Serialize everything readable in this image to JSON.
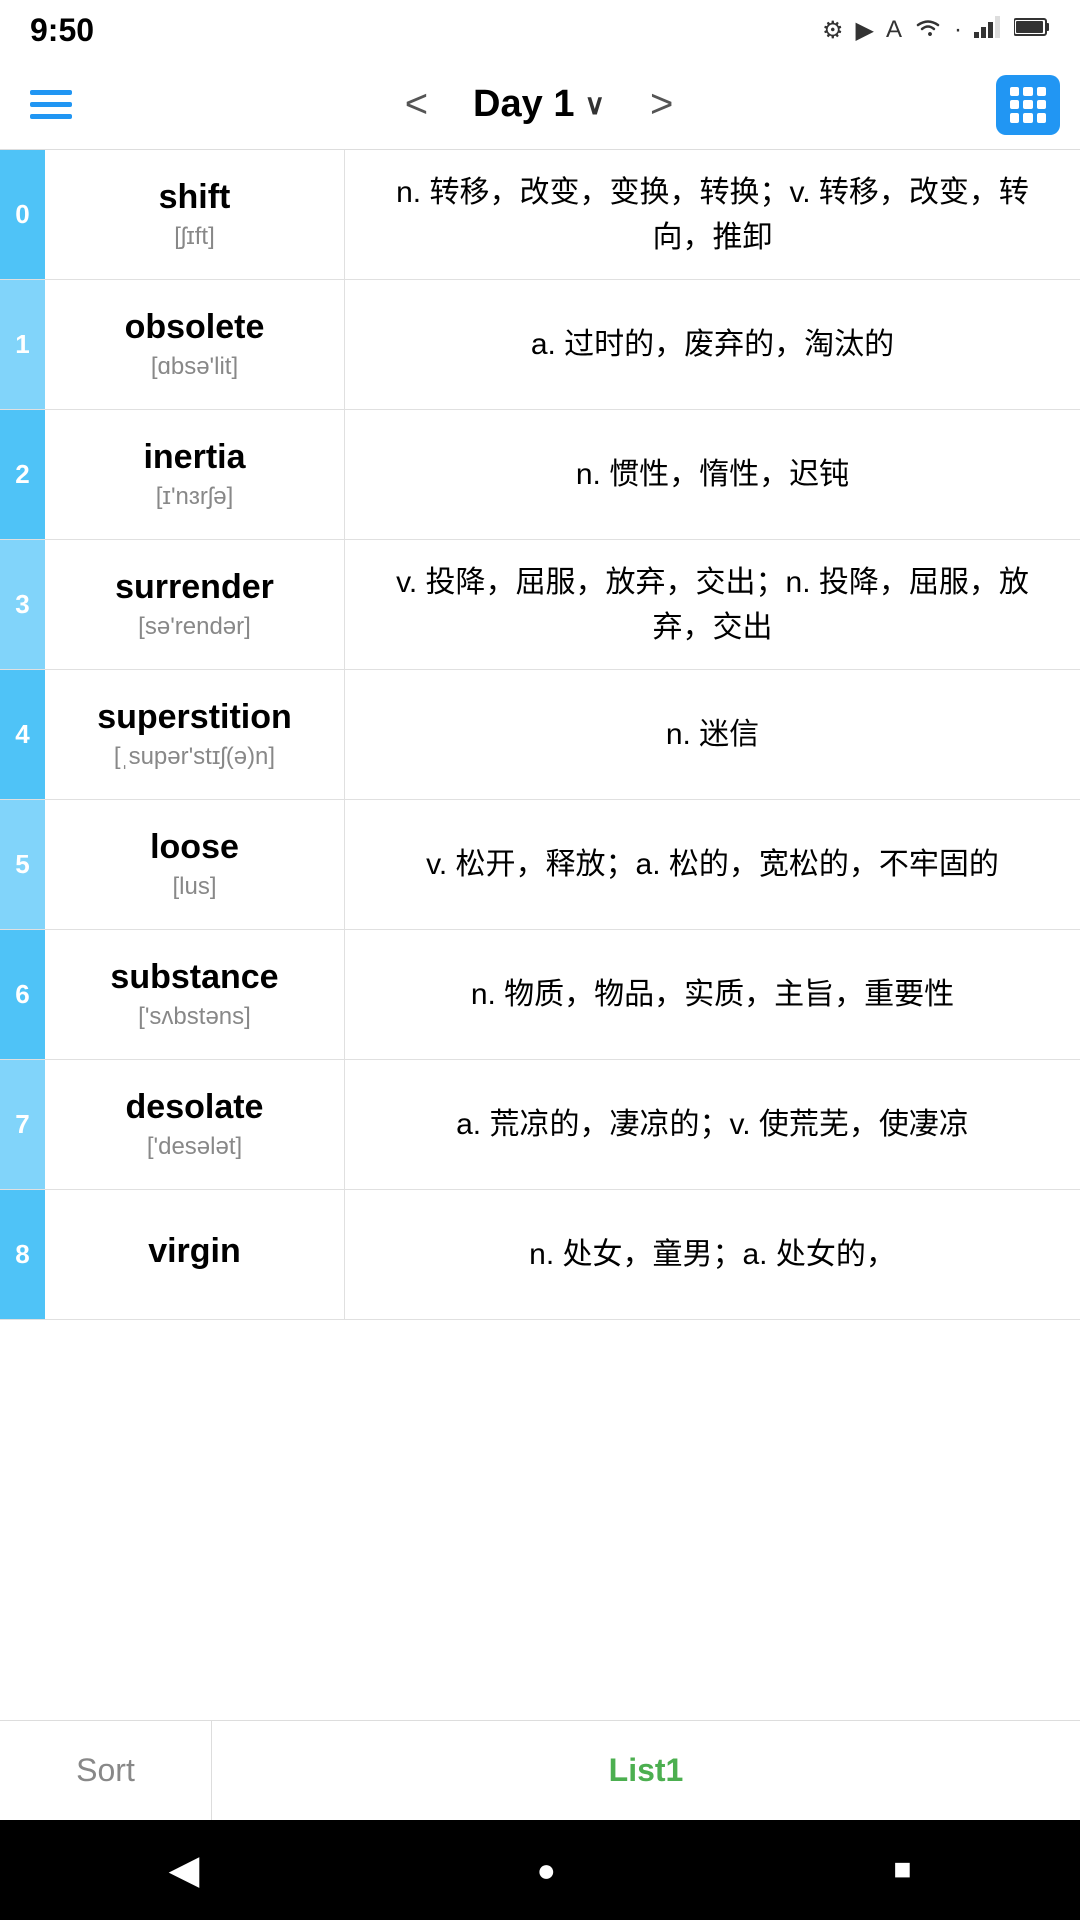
{
  "statusBar": {
    "time": "9:50",
    "icons": [
      "gear",
      "play",
      "A",
      "wifi",
      "dot",
      "signal",
      "battery"
    ]
  },
  "toolbar": {
    "menuLabel": "menu",
    "prevLabel": "<",
    "nextLabel": ">",
    "title": "Day 1",
    "titleChevron": "∨",
    "gridLabel": "grid view"
  },
  "words": [
    {
      "index": "0",
      "word": "shift",
      "phonetic": "[ʃɪft]",
      "definition": "n. 转移，改变，变换，转换；v. 转移，改变，转向，推卸",
      "indexAlt": false
    },
    {
      "index": "1",
      "word": "obsolete",
      "phonetic": "[ɑbsə'lit]",
      "definition": "a. 过时的，废弃的，淘汰的",
      "indexAlt": true
    },
    {
      "index": "2",
      "word": "inertia",
      "phonetic": "[ɪ'nɜrʃə]",
      "definition": "n. 惯性，惰性，迟钝",
      "indexAlt": false
    },
    {
      "index": "3",
      "word": "surrender",
      "phonetic": "[sə'rendər]",
      "definition": "v. 投降，屈服，放弃，交出；n. 投降，屈服，放弃，交出",
      "indexAlt": true
    },
    {
      "index": "4",
      "word": "superstition",
      "phonetic": "[ˌsupər'stɪʃ(ə)n]",
      "definition": "n. 迷信",
      "indexAlt": false
    },
    {
      "index": "5",
      "word": "loose",
      "phonetic": "[lus]",
      "definition": "v. 松开，释放；a. 松的，宽松的，不牢固的",
      "indexAlt": true
    },
    {
      "index": "6",
      "word": "substance",
      "phonetic": "['sʌbstəns]",
      "definition": "n. 物质，物品，实质，主旨，重要性",
      "indexAlt": false
    },
    {
      "index": "7",
      "word": "desolate",
      "phonetic": "['desələt]",
      "definition": "a. 荒凉的，凄凉的；v. 使荒芜，使凄凉",
      "indexAlt": true
    },
    {
      "index": "8",
      "word": "virgin",
      "phonetic": "",
      "definition": "n. 处女，童男；a. 处女的，",
      "indexAlt": false
    }
  ],
  "bottomTabs": {
    "sortLabel": "Sort",
    "list1Label": "List1"
  },
  "navBar": {
    "backLabel": "◀",
    "homeLabel": "●",
    "recentsLabel": "■"
  }
}
